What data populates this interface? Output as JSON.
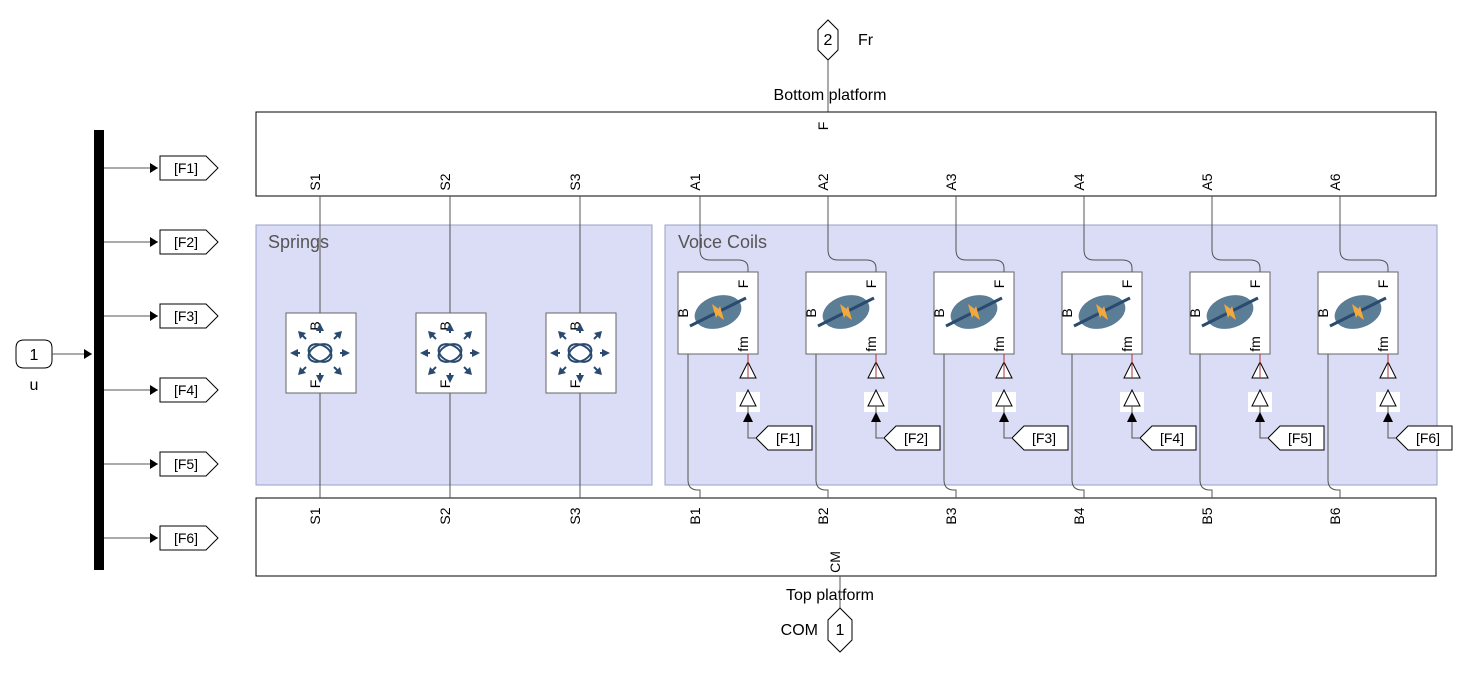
{
  "input_port": {
    "number": "1",
    "name": "u"
  },
  "output_port": {
    "number": "2",
    "name": "Fr"
  },
  "conn_port": {
    "number": "1",
    "name": "COM"
  },
  "goto_tags": [
    "[F1]",
    "[F2]",
    "[F3]",
    "[F4]",
    "[F5]",
    "[F6]"
  ],
  "from_tags": [
    "[F1]",
    "[F2]",
    "[F3]",
    "[F4]",
    "[F5]",
    "[F6]"
  ],
  "top_block": {
    "title": "Bottom platform",
    "port_F": "F",
    "ports": [
      "S1",
      "S2",
      "S3",
      "A1",
      "A2",
      "A3",
      "A4",
      "A5",
      "A6"
    ]
  },
  "bottom_block": {
    "title": "Top platform",
    "port_CM": "CM",
    "ports": [
      "S1",
      "S2",
      "S3",
      "B1",
      "B2",
      "B3",
      "B4",
      "B5",
      "B6"
    ]
  },
  "springs_subsystem": {
    "title": "Springs",
    "blocks": [
      {
        "port_B": "B",
        "port_F": "F"
      },
      {
        "port_B": "B",
        "port_F": "F"
      },
      {
        "port_B": "B",
        "port_F": "F"
      }
    ]
  },
  "voicecoils_subsystem": {
    "title": "Voice Coils",
    "blocks": [
      {
        "port_B": "B",
        "port_F": "F",
        "port_fm": "fm"
      },
      {
        "port_B": "B",
        "port_F": "F",
        "port_fm": "fm"
      },
      {
        "port_B": "B",
        "port_F": "F",
        "port_fm": "fm"
      },
      {
        "port_B": "B",
        "port_F": "F",
        "port_fm": "fm"
      },
      {
        "port_B": "B",
        "port_F": "F",
        "port_fm": "fm"
      },
      {
        "port_B": "B",
        "port_F": "F",
        "port_fm": "fm"
      }
    ]
  }
}
